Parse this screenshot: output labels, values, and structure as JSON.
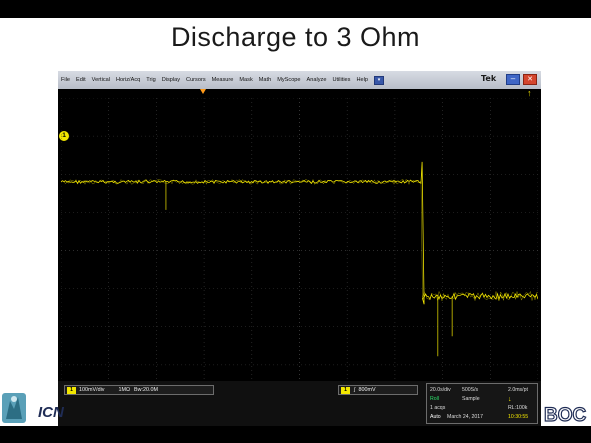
{
  "slide": {
    "title": "Discharge to 3 Ohm",
    "left_logo_text": "ICN",
    "right_logo_text": "BOC"
  },
  "scope": {
    "menu": [
      "File",
      "Edit",
      "Vertical",
      "Horiz/Acq",
      "Trig",
      "Display",
      "Cursors",
      "Measure",
      "Mask",
      "Math",
      "MyScope",
      "Analyze",
      "Utilities",
      "Help"
    ],
    "help_button_glyph": "▾",
    "brand": "Tek",
    "minimize_glyph": "–",
    "close_glyph": "✕",
    "ch1_marker": "1",
    "channel": {
      "badge": "1",
      "scale": "100mV/div",
      "impedance": "1MΩ",
      "bandwidth": "Bw:20.0M"
    },
    "trigger": {
      "badge": "1",
      "slope": "∫",
      "level": "800mV"
    },
    "acquisition": {
      "timebase": "20.0s/div",
      "sample_rate": "500S/s",
      "resolution": "2.0ms/pt",
      "run_state": "Roll",
      "mode": "Sample",
      "acqs": "1 acqs",
      "record_length": "RL:100k",
      "trigger_mode": "Auto",
      "date": "March 24, 2017",
      "time": "10:30:55",
      "level_marker": "↓"
    },
    "colors": {
      "trace": "#f2e600",
      "grid": "#3a3a3a",
      "grid_center": "#5a5a5a"
    },
    "trace_data": {
      "high_level_divisions": 1.8,
      "low_level_divisions": -1.2,
      "step_time_fraction": 0.757
    }
  }
}
